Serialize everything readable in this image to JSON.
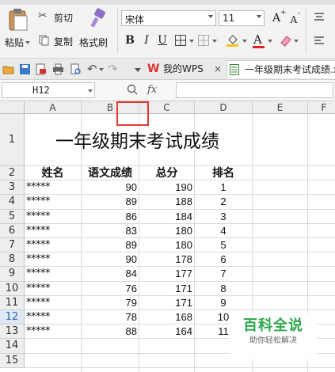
{
  "ribbon": {
    "cut_label": "剪切",
    "paste_label": "粘贴",
    "copy_label": "复制",
    "format_painter_label": "格式刷",
    "font_name": "宋体",
    "font_size": "11",
    "bold": "B",
    "italic": "I",
    "underline": "U",
    "grow_font": "A",
    "shrink_font": "A",
    "font_color": "A"
  },
  "quickbar": {
    "tabs": [
      {
        "label": "我的WPS"
      },
      {
        "label": "一年级期末考试成绩.x"
      }
    ]
  },
  "formula_bar": {
    "cell_ref": "H12",
    "fx": "fx",
    "formula": ""
  },
  "sheet": {
    "columns": [
      "A",
      "B",
      "C",
      "D",
      "E",
      "F"
    ],
    "rows": [
      "1",
      "2",
      "3",
      "4",
      "5",
      "6",
      "7",
      "8",
      "9",
      "10",
      "11",
      "12",
      "13",
      "14",
      "15"
    ],
    "selected_row": "12",
    "title": "一年级期末考试成绩",
    "headers": [
      "姓名",
      "语文成绩",
      "总分",
      "排名"
    ],
    "data": [
      {
        "name": "*****",
        "chinese": "90",
        "total": "190",
        "rank": "1"
      },
      {
        "name": "*****",
        "chinese": "89",
        "total": "188",
        "rank": "2"
      },
      {
        "name": "*****",
        "chinese": "86",
        "total": "184",
        "rank": "3"
      },
      {
        "name": "*****",
        "chinese": "83",
        "total": "180",
        "rank": "4"
      },
      {
        "name": "*****",
        "chinese": "89",
        "total": "180",
        "rank": "5"
      },
      {
        "name": "*****",
        "chinese": "90",
        "total": "178",
        "rank": "6"
      },
      {
        "name": "*****",
        "chinese": "84",
        "total": "177",
        "rank": "7"
      },
      {
        "name": "*****",
        "chinese": "76",
        "total": "171",
        "rank": "8"
      },
      {
        "name": "*****",
        "chinese": "79",
        "total": "171",
        "rank": "9"
      },
      {
        "name": "*****",
        "chinese": "78",
        "total": "168",
        "rank": "10"
      },
      {
        "name": "*****",
        "chinese": "88",
        "total": "164",
        "rank": "11"
      }
    ]
  },
  "watermark": {
    "main": "百科全说",
    "sub": "助你轻松解决"
  },
  "colors": {
    "highlight_box": "#e23a35",
    "selected_row_header": "#2b6bb1",
    "watermark_green": "#2aa84a",
    "wps_red": "#d9322b"
  }
}
